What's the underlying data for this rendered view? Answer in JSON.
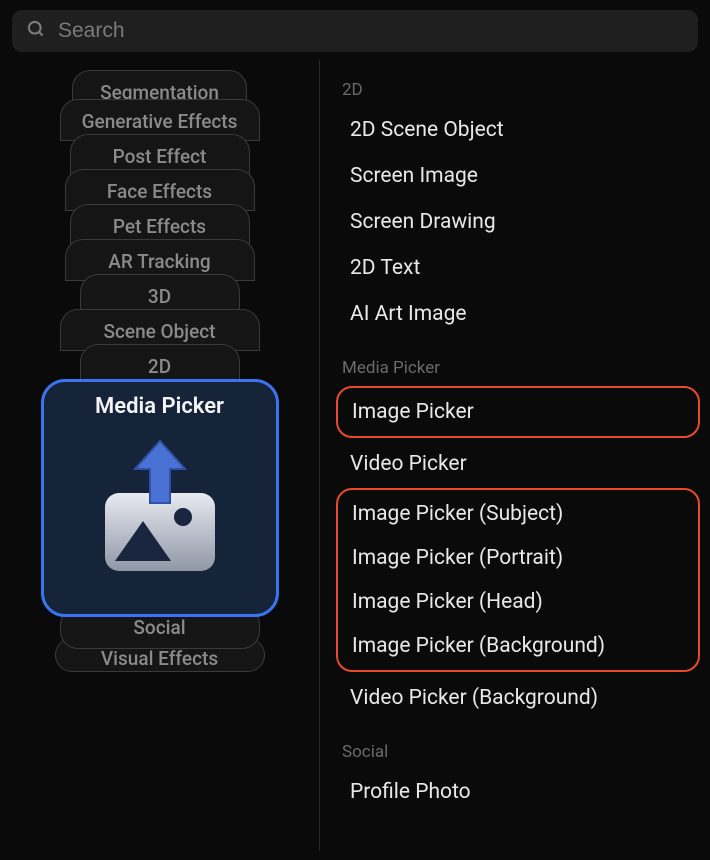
{
  "search": {
    "placeholder": "Search"
  },
  "leftCards": {
    "above": [
      "Segmentation",
      "Generative Effects",
      "Post Effect",
      "Face Effects",
      "Pet Effects",
      "AR Tracking",
      "3D",
      "Scene Object",
      "2D"
    ],
    "active": "Media Picker",
    "below": [
      "Social",
      "Visual Effects"
    ]
  },
  "rightPanel": {
    "sections": {
      "twoD": {
        "header": "2D",
        "items": [
          "2D Scene Object",
          "Screen Image",
          "Screen Drawing",
          "2D Text",
          "AI Art Image"
        ]
      },
      "mediaPicker": {
        "header": "Media Picker",
        "highlightedA": [
          "Image Picker"
        ],
        "between": [
          "Video Picker"
        ],
        "highlightedB": [
          "Image Picker (Subject)",
          "Image Picker (Portrait)",
          "Image Picker (Head)",
          "Image Picker (Background)"
        ],
        "after": [
          "Video Picker (Background)"
        ]
      },
      "social": {
        "header": "Social",
        "items": [
          "Profile Photo"
        ]
      }
    }
  }
}
